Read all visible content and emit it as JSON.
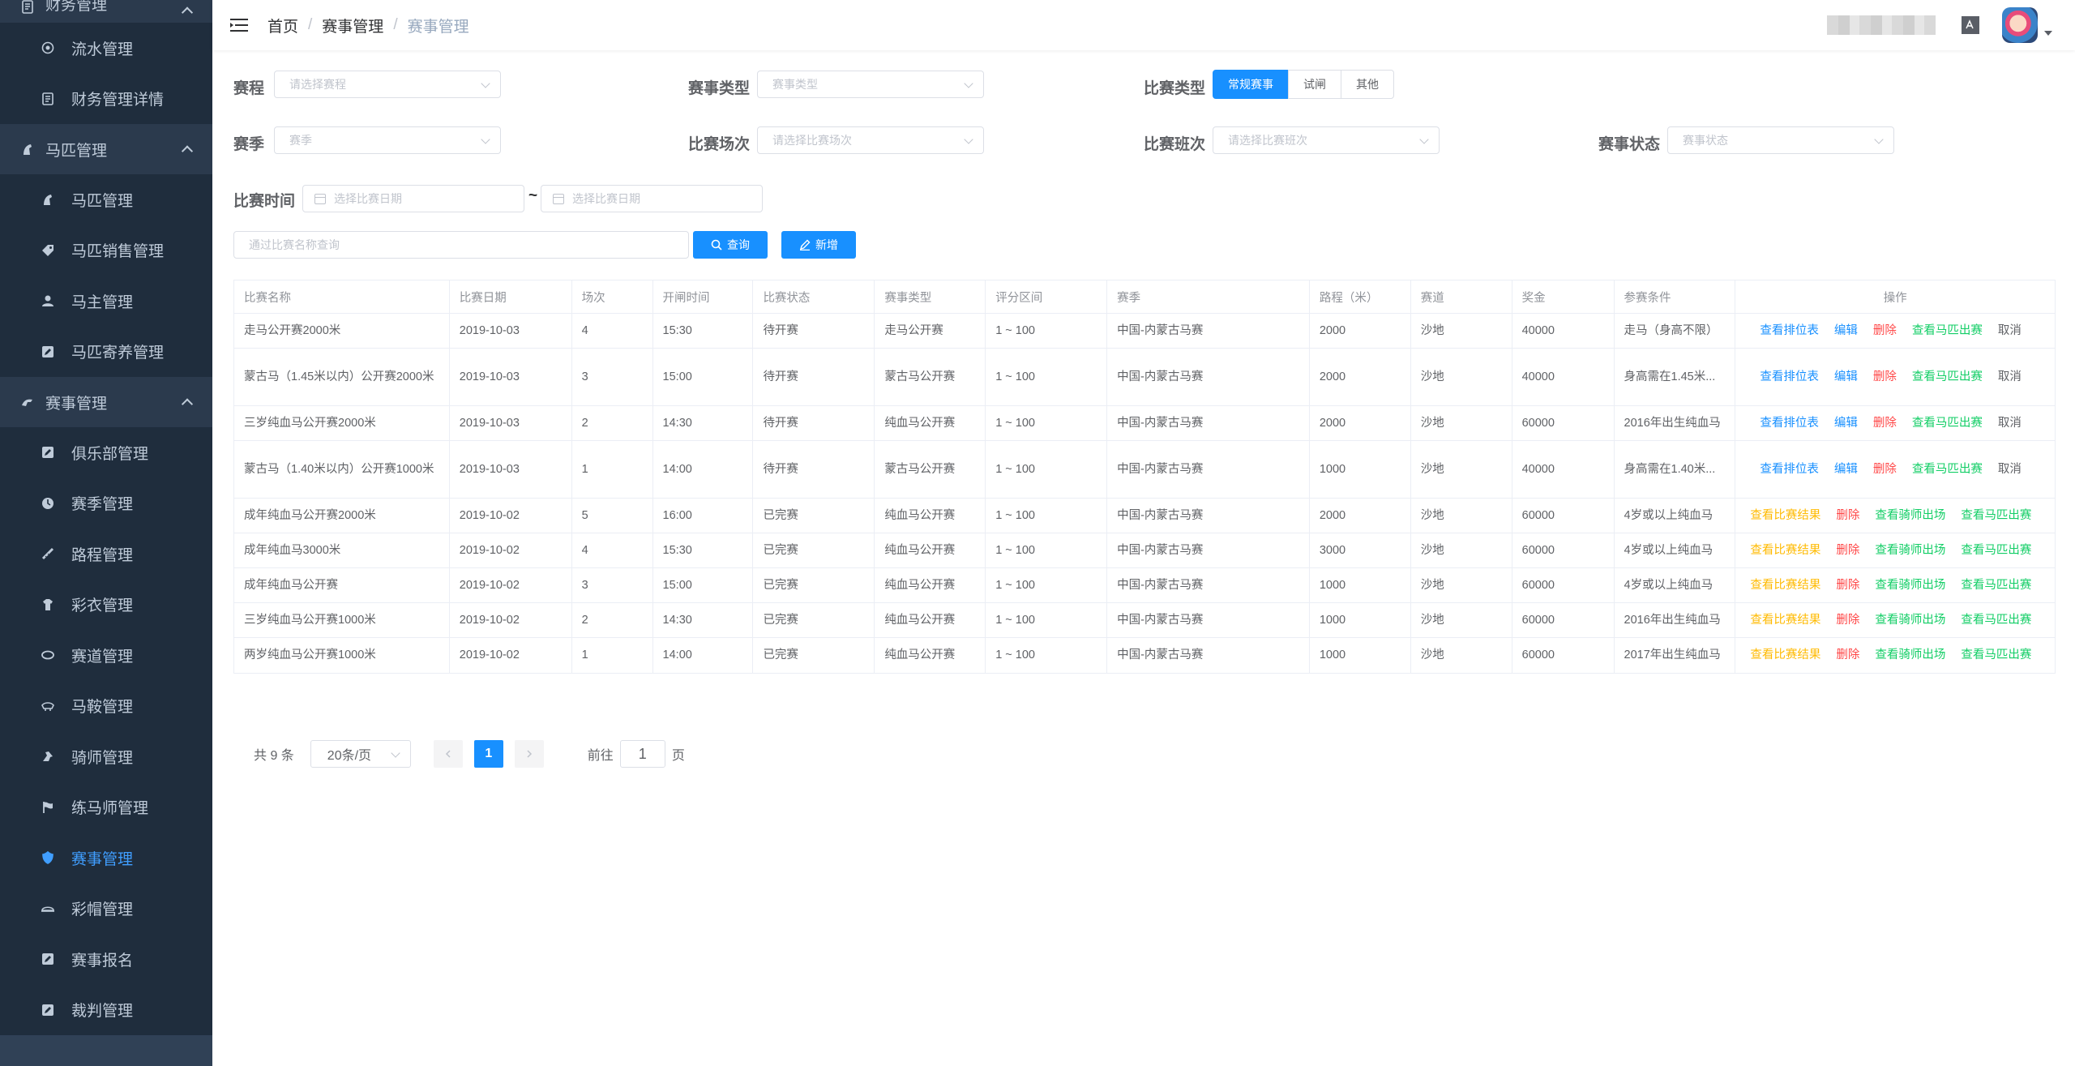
{
  "sidebar": {
    "groups": [
      {
        "label": "财务管理",
        "icon": "finance-icon",
        "items": [
          {
            "label": "流水管理",
            "icon": "flow-icon"
          },
          {
            "label": "财务管理详情",
            "icon": "finance-detail-icon"
          }
        ]
      },
      {
        "label": "马匹管理",
        "icon": "horse-icon",
        "items": [
          {
            "label": "马匹管理",
            "icon": "horse-icon"
          },
          {
            "label": "马匹销售管理",
            "icon": "tag-icon"
          },
          {
            "label": "马主管理",
            "icon": "user-icon"
          },
          {
            "label": "马匹寄养管理",
            "icon": "edit-icon"
          }
        ]
      },
      {
        "label": "赛事管理",
        "icon": "race-icon",
        "items": [
          {
            "label": "俱乐部管理",
            "icon": "edit-icon"
          },
          {
            "label": "赛季管理",
            "icon": "season-icon"
          },
          {
            "label": "路程管理",
            "icon": "ruler-icon"
          },
          {
            "label": "彩衣管理",
            "icon": "shirt-icon"
          },
          {
            "label": "赛道管理",
            "icon": "track-icon"
          },
          {
            "label": "马鞍管理",
            "icon": "saddle-icon"
          },
          {
            "label": "骑师管理",
            "icon": "jockey-icon"
          },
          {
            "label": "练马师管理",
            "icon": "flag-icon"
          },
          {
            "label": "赛事管理",
            "icon": "shield-icon",
            "active": true
          },
          {
            "label": "彩帽管理",
            "icon": "cap-icon"
          },
          {
            "label": "赛事报名",
            "icon": "edit-icon"
          },
          {
            "label": "裁判管理",
            "icon": "edit-icon"
          }
        ]
      }
    ]
  },
  "header": {
    "breadcrumb": [
      "首页",
      "赛事管理",
      "赛事管理"
    ],
    "separator": "/"
  },
  "filters": {
    "course": {
      "label": "赛程",
      "placeholder": "请选择赛程"
    },
    "event_type": {
      "label": "赛事类型",
      "placeholder": "赛事类型"
    },
    "match_type": {
      "label": "比赛类型",
      "options": [
        "常规赛事",
        "试闸",
        "其他"
      ],
      "selected": "常规赛事"
    },
    "season": {
      "label": "赛季",
      "placeholder": "赛季"
    },
    "match_round": {
      "label": "比赛场次",
      "placeholder": "请选择比赛场次"
    },
    "match_class": {
      "label": "比赛班次",
      "placeholder": "请选择比赛班次"
    },
    "event_status": {
      "label": "赛事状态",
      "placeholder": "赛事状态"
    },
    "match_time": {
      "label": "比赛时间",
      "start_placeholder": "选择比赛日期",
      "separator": "~",
      "end_placeholder": "选择比赛日期"
    },
    "search": {
      "placeholder": "通过比赛名称查询"
    },
    "query_button": "查询",
    "add_button": "新增"
  },
  "table": {
    "columns": [
      "比赛名称",
      "比赛日期",
      "场次",
      "开闸时间",
      "比赛状态",
      "赛事类型",
      "评分区间",
      "赛季",
      "路程（米）",
      "赛道",
      "奖金",
      "参赛条件",
      "操作"
    ],
    "rows": [
      {
        "name": "走马公开赛2000米",
        "date": "2019-10-03",
        "round": "4",
        "gate_time": "15:30",
        "status": "待开赛",
        "type": "走马公开赛",
        "rating": "1 ~ 100",
        "season": "中国-内蒙古马赛",
        "distance": "2000",
        "track": "沙地",
        "prize": "40000",
        "condition": "走马（身高不限）",
        "ops": [
          {
            "label": "查看排位表",
            "color": "blue"
          },
          {
            "label": "编辑",
            "color": "blue"
          },
          {
            "label": "删除",
            "color": "red"
          },
          {
            "label": "查看马匹出赛",
            "color": "green"
          },
          {
            "label": "取消",
            "color": "gray"
          }
        ]
      },
      {
        "name": "蒙古马（1.45米以内）公开赛2000米",
        "date": "2019-10-03",
        "round": "3",
        "gate_time": "15:00",
        "status": "待开赛",
        "type": "蒙古马公开赛",
        "rating": "1 ~ 100",
        "season": "中国-内蒙古马赛",
        "distance": "2000",
        "track": "沙地",
        "prize": "40000",
        "condition": "身高需在1.45米...",
        "ops": [
          {
            "label": "查看排位表",
            "color": "blue"
          },
          {
            "label": "编辑",
            "color": "blue"
          },
          {
            "label": "删除",
            "color": "red"
          },
          {
            "label": "查看马匹出赛",
            "color": "green"
          },
          {
            "label": "取消",
            "color": "gray"
          }
        ]
      },
      {
        "name": "三岁纯血马公开赛2000米",
        "date": "2019-10-03",
        "round": "2",
        "gate_time": "14:30",
        "status": "待开赛",
        "type": "纯血马公开赛",
        "rating": "1 ~ 100",
        "season": "中国-内蒙古马赛",
        "distance": "2000",
        "track": "沙地",
        "prize": "60000",
        "condition": "2016年出生纯血马",
        "ops": [
          {
            "label": "查看排位表",
            "color": "blue"
          },
          {
            "label": "编辑",
            "color": "blue"
          },
          {
            "label": "删除",
            "color": "red"
          },
          {
            "label": "查看马匹出赛",
            "color": "green"
          },
          {
            "label": "取消",
            "color": "gray"
          }
        ]
      },
      {
        "name": "蒙古马（1.40米以内）公开赛1000米",
        "date": "2019-10-03",
        "round": "1",
        "gate_time": "14:00",
        "status": "待开赛",
        "type": "蒙古马公开赛",
        "rating": "1 ~ 100",
        "season": "中国-内蒙古马赛",
        "distance": "1000",
        "track": "沙地",
        "prize": "40000",
        "condition": "身高需在1.40米...",
        "ops": [
          {
            "label": "查看排位表",
            "color": "blue"
          },
          {
            "label": "编辑",
            "color": "blue"
          },
          {
            "label": "删除",
            "color": "red"
          },
          {
            "label": "查看马匹出赛",
            "color": "green"
          },
          {
            "label": "取消",
            "color": "gray"
          }
        ]
      },
      {
        "name": "成年纯血马公开赛2000米",
        "date": "2019-10-02",
        "round": "5",
        "gate_time": "16:00",
        "status": "已完赛",
        "type": "纯血马公开赛",
        "rating": "1 ~ 100",
        "season": "中国-内蒙古马赛",
        "distance": "2000",
        "track": "沙地",
        "prize": "60000",
        "condition": "4岁或以上纯血马",
        "ops": [
          {
            "label": "查看比赛结果",
            "color": "orange"
          },
          {
            "label": "删除",
            "color": "red"
          },
          {
            "label": "查看骑师出场",
            "color": "green"
          },
          {
            "label": "查看马匹出赛",
            "color": "green"
          }
        ]
      },
      {
        "name": "成年纯血马3000米",
        "date": "2019-10-02",
        "round": "4",
        "gate_time": "15:30",
        "status": "已完赛",
        "type": "纯血马公开赛",
        "rating": "1 ~ 100",
        "season": "中国-内蒙古马赛",
        "distance": "3000",
        "track": "沙地",
        "prize": "60000",
        "condition": "4岁或以上纯血马",
        "ops": [
          {
            "label": "查看比赛结果",
            "color": "orange"
          },
          {
            "label": "删除",
            "color": "red"
          },
          {
            "label": "查看骑师出场",
            "color": "green"
          },
          {
            "label": "查看马匹出赛",
            "color": "green"
          }
        ]
      },
      {
        "name": "成年纯血马公开赛",
        "date": "2019-10-02",
        "round": "3",
        "gate_time": "15:00",
        "status": "已完赛",
        "type": "纯血马公开赛",
        "rating": "1 ~ 100",
        "season": "中国-内蒙古马赛",
        "distance": "1000",
        "track": "沙地",
        "prize": "60000",
        "condition": "4岁或以上纯血马",
        "ops": [
          {
            "label": "查看比赛结果",
            "color": "orange"
          },
          {
            "label": "删除",
            "color": "red"
          },
          {
            "label": "查看骑师出场",
            "color": "green"
          },
          {
            "label": "查看马匹出赛",
            "color": "green"
          }
        ]
      },
      {
        "name": "三岁纯血马公开赛1000米",
        "date": "2019-10-02",
        "round": "2",
        "gate_time": "14:30",
        "status": "已完赛",
        "type": "纯血马公开赛",
        "rating": "1 ~ 100",
        "season": "中国-内蒙古马赛",
        "distance": "1000",
        "track": "沙地",
        "prize": "60000",
        "condition": "2016年出生纯血马",
        "ops": [
          {
            "label": "查看比赛结果",
            "color": "orange"
          },
          {
            "label": "删除",
            "color": "red"
          },
          {
            "label": "查看骑师出场",
            "color": "green"
          },
          {
            "label": "查看马匹出赛",
            "color": "green"
          }
        ]
      },
      {
        "name": "两岁纯血马公开赛1000米",
        "date": "2019-10-02",
        "round": "1",
        "gate_time": "14:00",
        "status": "已完赛",
        "type": "纯血马公开赛",
        "rating": "1 ~ 100",
        "season": "中国-内蒙古马赛",
        "distance": "1000",
        "track": "沙地",
        "prize": "60000",
        "condition": "2017年出生纯血马",
        "ops": [
          {
            "label": "查看比赛结果",
            "color": "orange"
          },
          {
            "label": "删除",
            "color": "red"
          },
          {
            "label": "查看骑师出场",
            "color": "green"
          },
          {
            "label": "查看马匹出赛",
            "color": "green"
          }
        ]
      }
    ]
  },
  "pagination": {
    "total": "共 9 条",
    "page_size": "20条/页",
    "current_page": "1",
    "goto_prefix": "前往",
    "goto_value": "1",
    "goto_suffix": "页"
  },
  "colors": {
    "sidebar_bg": "#304156",
    "primary": "#1890ff",
    "danger": "#ff4949",
    "success": "#13ce66",
    "warning": "#ffba00"
  }
}
